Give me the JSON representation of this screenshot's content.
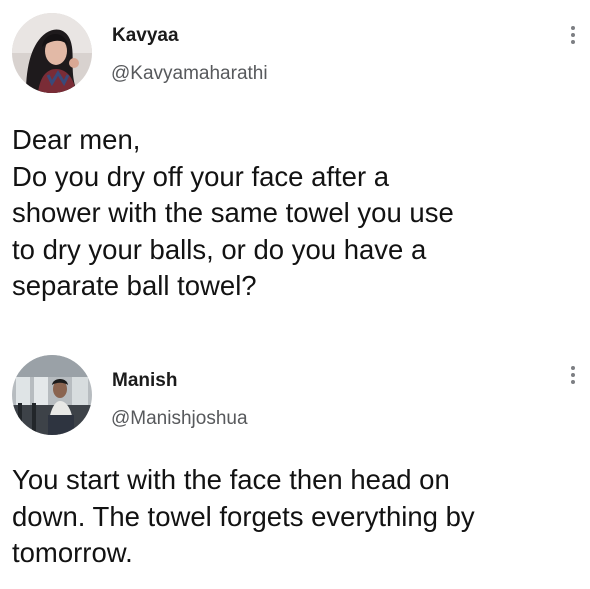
{
  "tweets": [
    {
      "name": "Kavyaa",
      "handle": "@Kavyamaharathi",
      "lines": [
        "Dear men,",
        "Do you dry off your face after a",
        "shower with the same towel you use",
        "to dry your balls, or do you have a",
        "separate ball towel?"
      ]
    },
    {
      "name": "Manish",
      "handle": "@Manishjoshua",
      "lines": [
        "You start with the face then head on",
        "down. The towel forgets everything by",
        "tomorrow."
      ]
    }
  ],
  "icons": {
    "more": "more-vertical-icon"
  },
  "colors": {
    "background": "#ffffff",
    "text": "#121212",
    "handle": "#57595c",
    "icon": "#7d7f83"
  }
}
